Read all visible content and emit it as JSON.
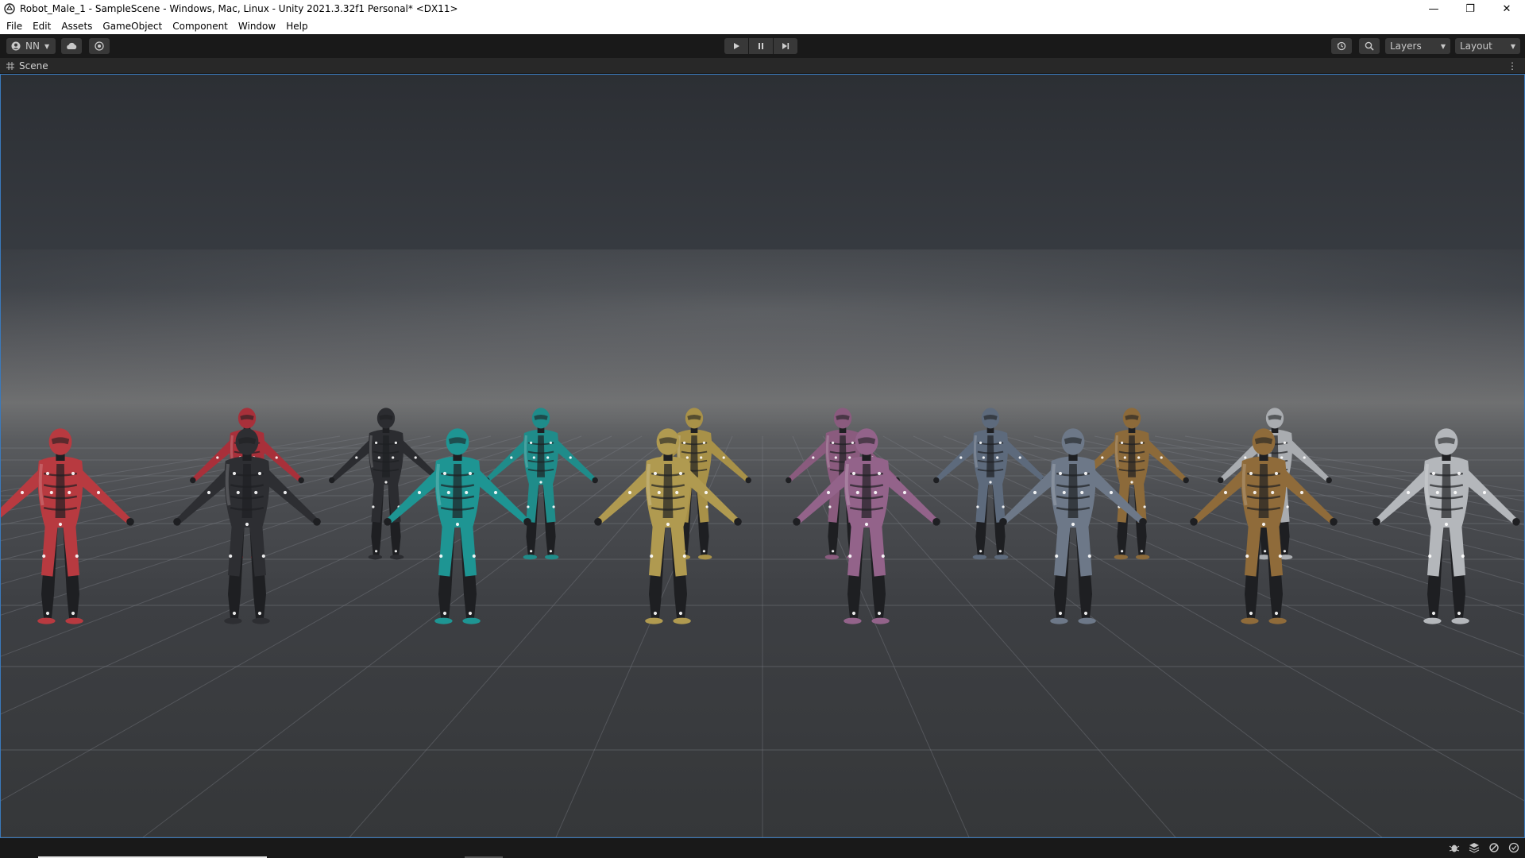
{
  "window": {
    "title": "Robot_Male_1 - SampleScene - Windows, Mac, Linux - Unity 2021.3.32f1 Personal* <DX11>",
    "controls": {
      "minimize": "—",
      "restore": "❐",
      "close": "✕"
    }
  },
  "menu": {
    "items": [
      "File",
      "Edit",
      "Assets",
      "GameObject",
      "Component",
      "Window",
      "Help"
    ]
  },
  "toolbar": {
    "account_label": "NN",
    "layers_label": "Layers",
    "layout_label": "Layout",
    "icons": {
      "account": "account-icon",
      "cloud": "cloud-icon",
      "collab": "collab-icon",
      "play": "play-icon",
      "pause": "pause-icon",
      "step": "step-icon",
      "history": "history-icon",
      "search": "search-icon"
    }
  },
  "scene_tab": {
    "label": "Scene",
    "icon": "grid-icon",
    "menu_glyph": "⋮"
  },
  "scene": {
    "robots_back_row": [
      {
        "name": "red",
        "color": "#a8303a"
      },
      {
        "name": "black",
        "color": "#2b2c30"
      },
      {
        "name": "teal",
        "color": "#1f8c8a"
      },
      {
        "name": "gold",
        "color": "#a89148"
      },
      {
        "name": "purple",
        "color": "#8a5b7e"
      },
      {
        "name": "blue-grey",
        "color": "#5d6a7c"
      },
      {
        "name": "bronze",
        "color": "#8c6a3a"
      },
      {
        "name": "silver",
        "color": "#a9acb0"
      }
    ],
    "robots_front_row": [
      {
        "name": "red",
        "color": "#b83a40"
      },
      {
        "name": "black",
        "color": "#2d2e32"
      },
      {
        "name": "teal",
        "color": "#1e9593"
      },
      {
        "name": "gold",
        "color": "#b09a50"
      },
      {
        "name": "purple",
        "color": "#93638a"
      },
      {
        "name": "blue-grey",
        "color": "#6d7888"
      },
      {
        "name": "bronze",
        "color": "#8f6b3a"
      },
      {
        "name": "silver",
        "color": "#b4b7bb"
      }
    ]
  },
  "statusbar": {
    "icons": [
      "bug-icon",
      "layers-stack-icon",
      "debug-icon",
      "check-icon"
    ]
  }
}
